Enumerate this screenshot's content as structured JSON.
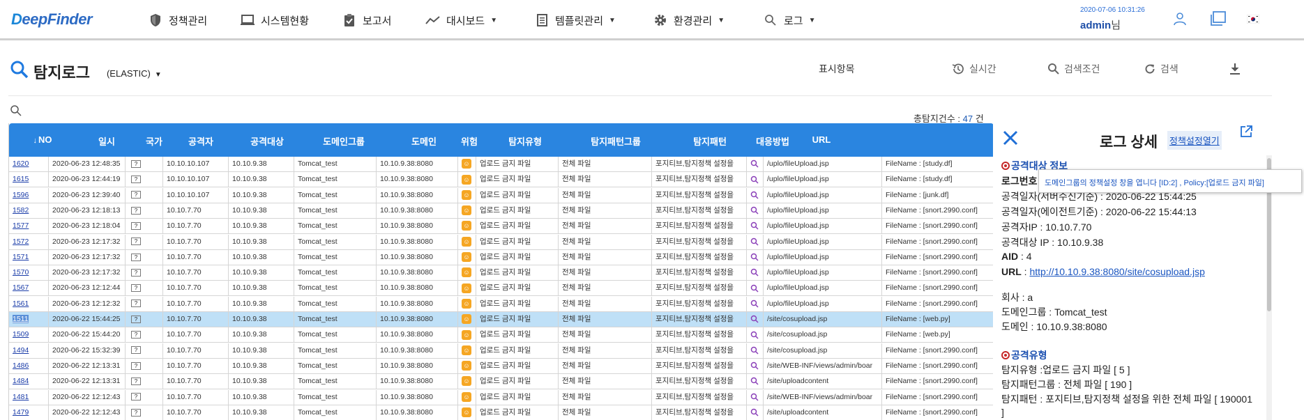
{
  "app": {
    "logo_prefix": "D",
    "logo_text": "eepFinder"
  },
  "nav": {
    "items": [
      {
        "label": "정책관리",
        "icon": "shield-icon"
      },
      {
        "label": "시스템현황",
        "icon": "monitor-icon"
      },
      {
        "label": "보고서",
        "icon": "clipboard-check-icon"
      },
      {
        "label": "대시보드",
        "icon": "trend-line-icon"
      },
      {
        "label": "템플릿관리",
        "icon": "document-list-icon"
      },
      {
        "label": "환경관리",
        "icon": "gear-icon"
      },
      {
        "label": "로그",
        "icon": "search-icon"
      }
    ],
    "datetime": "2020-07-06 10:31:26",
    "username": "admin",
    "user_suffix": "님"
  },
  "toolbar": {
    "title": "탐지로그",
    "source": "(ELASTIC)",
    "display_items": "표시항목",
    "realtime": "실시간",
    "search_conditions": "검색조건",
    "search": "검색",
    "total_label": "총탐지건수 : ",
    "total_count": "47",
    "total_unit": " 건"
  },
  "table": {
    "headers": [
      "NO",
      "일시",
      "국가",
      "공격자",
      "공격대상",
      "도메인그룹",
      "도메인",
      "위험",
      "탐지유형",
      "탐지패턴그룹",
      "탐지패턴",
      "대응방법",
      "URL"
    ],
    "rows": [
      {
        "no": "1620",
        "date": "2020-06-23 12:48:35",
        "attacker": "10.10.10.107",
        "target": "10.10.9.38",
        "dgroup": "Tomcat_test",
        "domain": "10.10.9.38:8080",
        "type": "업로드 금지 파일",
        "pgroup": "전체 파일",
        "pattern": "포지티브,탐지정책 설정을",
        "url": "/uplo/fileUpload.jsp",
        "extra": "FileName : [study.df]"
      },
      {
        "no": "1615",
        "date": "2020-06-23 12:44:19",
        "attacker": "10.10.10.107",
        "target": "10.10.9.38",
        "dgroup": "Tomcat_test",
        "domain": "10.10.9.38:8080",
        "type": "업로드 금지 파일",
        "pgroup": "전체 파일",
        "pattern": "포지티브,탐지정책 설정을",
        "url": "/uplo/fileUpload.jsp",
        "extra": "FileName : [study.df]"
      },
      {
        "no": "1596",
        "date": "2020-06-23 12:39:40",
        "attacker": "10.10.10.107",
        "target": "10.10.9.38",
        "dgroup": "Tomcat_test",
        "domain": "10.10.9.38:8080",
        "type": "업로드 금지 파일",
        "pgroup": "전체 파일",
        "pattern": "포지티브,탐지정책 설정을",
        "url": "/uplo/fileUpload.jsp",
        "extra": "FileName : [junk.df]"
      },
      {
        "no": "1582",
        "date": "2020-06-23 12:18:13",
        "attacker": "10.10.7.70",
        "target": "10.10.9.38",
        "dgroup": "Tomcat_test",
        "domain": "10.10.9.38:8080",
        "type": "업로드 금지 파일",
        "pgroup": "전체 파일",
        "pattern": "포지티브,탐지정책 설정을",
        "url": "/uplo/fileUpload.jsp",
        "extra": "FileName : [snort.2990.conf]"
      },
      {
        "no": "1577",
        "date": "2020-06-23 12:18:04",
        "attacker": "10.10.7.70",
        "target": "10.10.9.38",
        "dgroup": "Tomcat_test",
        "domain": "10.10.9.38:8080",
        "type": "업로드 금지 파일",
        "pgroup": "전체 파일",
        "pattern": "포지티브,탐지정책 설정을",
        "url": "/uplo/fileUpload.jsp",
        "extra": "FileName : [snort.2990.conf]"
      },
      {
        "no": "1572",
        "date": "2020-06-23 12:17:32",
        "attacker": "10.10.7.70",
        "target": "10.10.9.38",
        "dgroup": "Tomcat_test",
        "domain": "10.10.9.38:8080",
        "type": "업로드 금지 파일",
        "pgroup": "전체 파일",
        "pattern": "포지티브,탐지정책 설정을",
        "url": "/uplo/fileUpload.jsp",
        "extra": "FileName : [snort.2990.conf]"
      },
      {
        "no": "1571",
        "date": "2020-06-23 12:17:32",
        "attacker": "10.10.7.70",
        "target": "10.10.9.38",
        "dgroup": "Tomcat_test",
        "domain": "10.10.9.38:8080",
        "type": "업로드 금지 파일",
        "pgroup": "전체 파일",
        "pattern": "포지티브,탐지정책 설정을",
        "url": "/uplo/fileUpload.jsp",
        "extra": "FileName : [snort.2990.conf]"
      },
      {
        "no": "1570",
        "date": "2020-06-23 12:17:32",
        "attacker": "10.10.7.70",
        "target": "10.10.9.38",
        "dgroup": "Tomcat_test",
        "domain": "10.10.9.38:8080",
        "type": "업로드 금지 파일",
        "pgroup": "전체 파일",
        "pattern": "포지티브,탐지정책 설정을",
        "url": "/uplo/fileUpload.jsp",
        "extra": "FileName : [snort.2990.conf]"
      },
      {
        "no": "1567",
        "date": "2020-06-23 12:12:44",
        "attacker": "10.10.7.70",
        "target": "10.10.9.38",
        "dgroup": "Tomcat_test",
        "domain": "10.10.9.38:8080",
        "type": "업로드 금지 파일",
        "pgroup": "전체 파일",
        "pattern": "포지티브,탐지정책 설정을",
        "url": "/uplo/fileUpload.jsp",
        "extra": "FileName : [snort.2990.conf]"
      },
      {
        "no": "1561",
        "date": "2020-06-23 12:12:32",
        "attacker": "10.10.7.70",
        "target": "10.10.9.38",
        "dgroup": "Tomcat_test",
        "domain": "10.10.9.38:8080",
        "type": "업로드 금지 파일",
        "pgroup": "전체 파일",
        "pattern": "포지티브,탐지정책 설정을",
        "url": "/uplo/fileUpload.jsp",
        "extra": "FileName : [snort.2990.conf]"
      },
      {
        "no": "1511",
        "date": "2020-06-22 15:44:25",
        "attacker": "10.10.7.70",
        "target": "10.10.9.38",
        "dgroup": "Tomcat_test",
        "domain": "10.10.9.38:8080",
        "type": "업로드 금지 파일",
        "pgroup": "전체 파일",
        "pattern": "포지티브,탐지정책 설정을",
        "url": "/site/cosupload.jsp",
        "extra": "FileName : [web.py]",
        "selected": true
      },
      {
        "no": "1509",
        "date": "2020-06-22 15:44:20",
        "attacker": "10.10.7.70",
        "target": "10.10.9.38",
        "dgroup": "Tomcat_test",
        "domain": "10.10.9.38:8080",
        "type": "업로드 금지 파일",
        "pgroup": "전체 파일",
        "pattern": "포지티브,탐지정책 설정을",
        "url": "/site/cosupload.jsp",
        "extra": "FileName : [web.py]"
      },
      {
        "no": "1494",
        "date": "2020-06-22 15:32:39",
        "attacker": "10.10.7.70",
        "target": "10.10.9.38",
        "dgroup": "Tomcat_test",
        "domain": "10.10.9.38:8080",
        "type": "업로드 금지 파일",
        "pgroup": "전체 파일",
        "pattern": "포지티브,탐지정책 설정을",
        "url": "/site/cosupload.jsp",
        "extra": "FileName : [snort.2990.conf]"
      },
      {
        "no": "1486",
        "date": "2020-06-22 12:13:31",
        "attacker": "10.10.7.70",
        "target": "10.10.9.38",
        "dgroup": "Tomcat_test",
        "domain": "10.10.9.38:8080",
        "type": "업로드 금지 파일",
        "pgroup": "전체 파일",
        "pattern": "포지티브,탐지정책 설정을",
        "url": "/site/WEB-INF/views/admin/boar",
        "extra": "FileName : [snort.2990.conf]"
      },
      {
        "no": "1484",
        "date": "2020-06-22 12:13:31",
        "attacker": "10.10.7.70",
        "target": "10.10.9.38",
        "dgroup": "Tomcat_test",
        "domain": "10.10.9.38:8080",
        "type": "업로드 금지 파일",
        "pgroup": "전체 파일",
        "pattern": "포지티브,탐지정책 설정을",
        "url": "/site/uploadcontent",
        "extra": "FileName : [snort.2990.conf]"
      },
      {
        "no": "1481",
        "date": "2020-06-22 12:12:43",
        "attacker": "10.10.7.70",
        "target": "10.10.9.38",
        "dgroup": "Tomcat_test",
        "domain": "10.10.9.38:8080",
        "type": "업로드 금지 파일",
        "pgroup": "전체 파일",
        "pattern": "포지티브,탐지정책 설정을",
        "url": "/site/WEB-INF/views/admin/boar",
        "extra": "FileName : [snort.2990.conf]"
      },
      {
        "no": "1479",
        "date": "2020-06-22 12:12:43",
        "attacker": "10.10.7.70",
        "target": "10.10.9.38",
        "dgroup": "Tomcat_test",
        "domain": "10.10.9.38:8080",
        "type": "업로드 금지 파일",
        "pgroup": "전체 파일",
        "pattern": "포지티브,탐지정책 설정을",
        "url": "/site/uploadcontent",
        "extra": "FileName : [snort.2990.conf]"
      }
    ]
  },
  "detail": {
    "title": "로그 상세",
    "policy_button": "정책설정열기",
    "tooltip": "도메인그룹의 정책설정 창을 엽니다 [ID:2] , Policy:[업로드 금지 파일]",
    "section_attack_info": "공격대상 정보",
    "log_no_label": "로그번호",
    "attack_date_server": "공격일자(서버수신기준) : 2020-06-22 15:44:25",
    "attack_date_agent": "공격일자(에이전트기준) : 2020-06-22 15:44:13",
    "attacker_ip": "공격자IP : 10.10.7.70",
    "target_ip": "공격대상 IP : 10.10.9.38",
    "aid_label": "AID",
    "aid_value": " : 4",
    "url_label": "URL",
    "url_value": "http://10.10.9.38:8080/site/cosupload.jsp",
    "company": "회사 : a",
    "domain_group": "도메인그룹 : Tomcat_test",
    "domain": "도메인 : 10.10.9.38:8080",
    "section_attack_type": "공격유형",
    "detect_type": "탐지유형 :업로드 금지 파일 [ 5 ]",
    "pattern_group": "탐지패턴그룹 : 전체 파일 [ 190 ]",
    "pattern": "탐지패턴 : 포지티브,탐지정책 설정을 위한 전체 파일 [ 190001",
    "pattern_cont": "]"
  }
}
